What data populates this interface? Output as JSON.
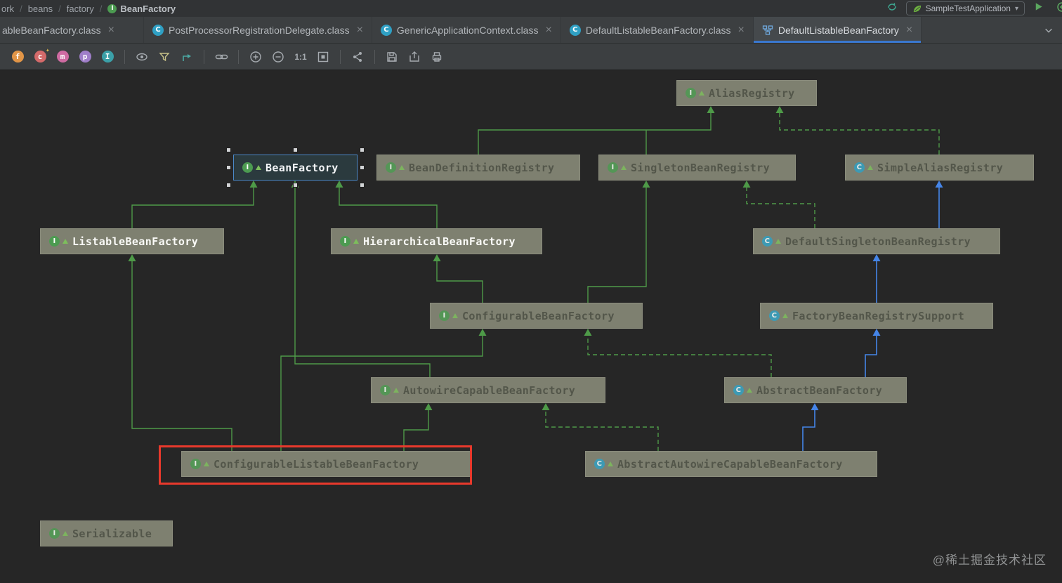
{
  "breadcrumbs": {
    "items": [
      "ork",
      "beans",
      "factory"
    ],
    "current": "BeanFactory",
    "separator": "/"
  },
  "header": {
    "run_config": "SampleTestApplication"
  },
  "tabs": {
    "close_glyph": "×",
    "items": [
      {
        "label": "ableBeanFactory.class",
        "kind": "class",
        "active": false
      },
      {
        "label": "PostProcessorRegistrationDelegate.class",
        "kind": "class",
        "active": false
      },
      {
        "label": "GenericApplicationContext.class",
        "kind": "class",
        "active": false
      },
      {
        "label": "DefaultListableBeanFactory.class",
        "kind": "class",
        "active": false
      },
      {
        "label": "DefaultListableBeanFactory",
        "kind": "uml-diagram",
        "active": true
      }
    ]
  },
  "toolbar": {
    "member_toggles": [
      {
        "label": "f",
        "name": "fields",
        "color": "#E19547"
      },
      {
        "label": "c",
        "name": "constructors",
        "color": "#D46A6A"
      },
      {
        "label": "m",
        "name": "methods",
        "color": "#CF6BA2"
      },
      {
        "label": "p",
        "name": "properties",
        "color": "#9F7EC9"
      },
      {
        "label": "I",
        "name": "inner-classes",
        "color": "#3BA0A8"
      }
    ],
    "zoom_label": "1:1"
  },
  "icons": {
    "interface": "I",
    "class": "C"
  },
  "diagram": {
    "nodes": [
      {
        "label": "AliasRegistry",
        "kind": "interface",
        "state": "dimmed"
      },
      {
        "label": "BeanFactory",
        "kind": "interface",
        "state": "selected"
      },
      {
        "label": "BeanDefinitionRegistry",
        "kind": "interface",
        "state": "dimmed"
      },
      {
        "label": "SingletonBeanRegistry",
        "kind": "interface",
        "state": "dimmed"
      },
      {
        "label": "SimpleAliasRegistry",
        "kind": "class",
        "state": "dimmed"
      },
      {
        "label": "ListableBeanFactory",
        "kind": "interface",
        "state": "normal"
      },
      {
        "label": "HierarchicalBeanFactory",
        "kind": "interface",
        "state": "normal"
      },
      {
        "label": "DefaultSingletonBeanRegistry",
        "kind": "class",
        "state": "dimmed"
      },
      {
        "label": "ConfigurableBeanFactory",
        "kind": "interface",
        "state": "dimmed"
      },
      {
        "label": "FactoryBeanRegistrySupport",
        "kind": "class",
        "state": "dimmed"
      },
      {
        "label": "AutowireCapableBeanFactory",
        "kind": "interface",
        "state": "dimmed"
      },
      {
        "label": "AbstractBeanFactory",
        "kind": "class",
        "state": "dimmed"
      },
      {
        "label": "ConfigurableListableBeanFactory",
        "kind": "interface",
        "state": "dimmed",
        "highlighted": true
      },
      {
        "label": "AbstractAutowireCapableBeanFactory",
        "kind": "class",
        "state": "dimmed"
      },
      {
        "label": "Serializable",
        "kind": "interface",
        "state": "dimmed"
      }
    ],
    "edges": [
      {
        "from": "BeanDefinitionRegistry",
        "to": "AliasRegistry",
        "relation": "extends"
      },
      {
        "from": "SingletonBeanRegistry",
        "to": "AliasRegistry",
        "relation": "extends"
      },
      {
        "from": "SimpleAliasRegistry",
        "to": "AliasRegistry",
        "relation": "implements"
      },
      {
        "from": "ListableBeanFactory",
        "to": "BeanFactory",
        "relation": "extends"
      },
      {
        "from": "HierarchicalBeanFactory",
        "to": "BeanFactory",
        "relation": "extends"
      },
      {
        "from": "AutowireCapableBeanFactory",
        "to": "BeanFactory",
        "relation": "extends"
      },
      {
        "from": "ConfigurableBeanFactory",
        "to": "HierarchicalBeanFactory",
        "relation": "extends"
      },
      {
        "from": "ConfigurableBeanFactory",
        "to": "SingletonBeanRegistry",
        "relation": "extends"
      },
      {
        "from": "DefaultSingletonBeanRegistry",
        "to": "SimpleAliasRegistry",
        "relation": "extends-class"
      },
      {
        "from": "DefaultSingletonBeanRegistry",
        "to": "SingletonBeanRegistry",
        "relation": "implements"
      },
      {
        "from": "FactoryBeanRegistrySupport",
        "to": "DefaultSingletonBeanRegistry",
        "relation": "extends-class"
      },
      {
        "from": "AbstractBeanFactory",
        "to": "FactoryBeanRegistrySupport",
        "relation": "extends-class"
      },
      {
        "from": "AbstractBeanFactory",
        "to": "ConfigurableBeanFactory",
        "relation": "implements"
      },
      {
        "from": "ConfigurableListableBeanFactory",
        "to": "ListableBeanFactory",
        "relation": "extends"
      },
      {
        "from": "ConfigurableListableBeanFactory",
        "to": "ConfigurableBeanFactory",
        "relation": "extends"
      },
      {
        "from": "ConfigurableListableBeanFactory",
        "to": "AutowireCapableBeanFactory",
        "relation": "extends"
      },
      {
        "from": "AbstractAutowireCapableBeanFactory",
        "to": "AbstractBeanFactory",
        "relation": "extends-class"
      },
      {
        "from": "AbstractAutowireCapableBeanFactory",
        "to": "AutowireCapableBeanFactory",
        "relation": "implements"
      }
    ]
  },
  "watermark": "@稀土掘金技术社区",
  "colors": {
    "background": "#262626",
    "bars": "#3C3F41",
    "node_fill": "#7E8070",
    "node_text_dimmed": "#53564A",
    "node_text_normal": "#FAFAF7",
    "edge_interface_green": "#4E9A48",
    "edge_class_blue": "#4585E8",
    "selection_blue": "#4A88C7",
    "highlight_red": "#E8392C",
    "tab_underline": "#3A78CF"
  }
}
